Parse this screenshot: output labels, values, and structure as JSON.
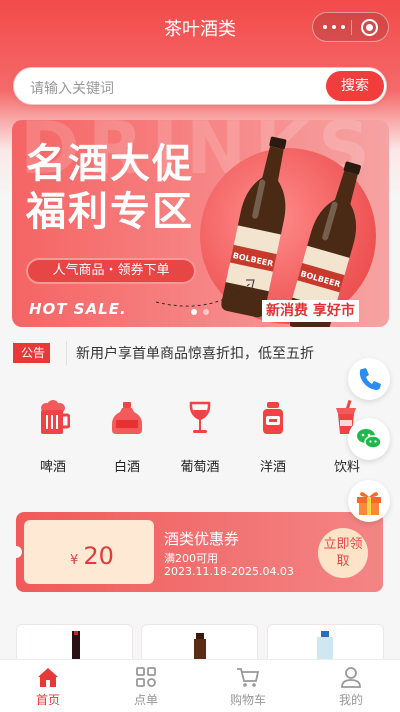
{
  "header": {
    "title": "茶叶酒类"
  },
  "search": {
    "placeholder": "请输入关键词",
    "button_label": "搜索"
  },
  "banner": {
    "bg_word": "DRINKS",
    "headline_line1": "名酒大促",
    "headline_line2": "福利专区",
    "tagline": "人气商品・领券下单",
    "hot_sale": "HOT SALE.",
    "slogan": "新消费 享好市",
    "bottle_label": "BOLBEER",
    "slides_total": 2,
    "slide_active": 1
  },
  "notice": {
    "tag": "公告",
    "text": "新用户享首单商品惊喜折扣，低至五折"
  },
  "categories": [
    {
      "label": "啤酒",
      "icon": "beer-mug-icon"
    },
    {
      "label": "白酒",
      "icon": "liquor-jar-icon"
    },
    {
      "label": "葡萄酒",
      "icon": "wine-glass-icon"
    },
    {
      "label": "洋酒",
      "icon": "whisky-bottle-icon"
    },
    {
      "label": "饮料",
      "icon": "soda-cup-icon"
    }
  ],
  "coupon": {
    "currency": "¥",
    "amount": "20",
    "title": "酒类优惠券",
    "condition": "满200可用",
    "validity": "2023.11.18-2025.04.03",
    "claim_label": "立即领取"
  },
  "floating_buttons": [
    "phone-icon",
    "wechat-icon",
    "gift-icon"
  ],
  "tabbar": [
    {
      "label": "首页",
      "icon": "home-icon",
      "active": true
    },
    {
      "label": "点单",
      "icon": "grid-menu-icon",
      "active": false
    },
    {
      "label": "购物车",
      "icon": "cart-icon",
      "active": false
    },
    {
      "label": "我的",
      "icon": "user-icon",
      "active": false
    }
  ],
  "colors": {
    "primary": "#f23d3d",
    "coupon_bg": "#fde9d4",
    "tab_active": "#e83838"
  }
}
